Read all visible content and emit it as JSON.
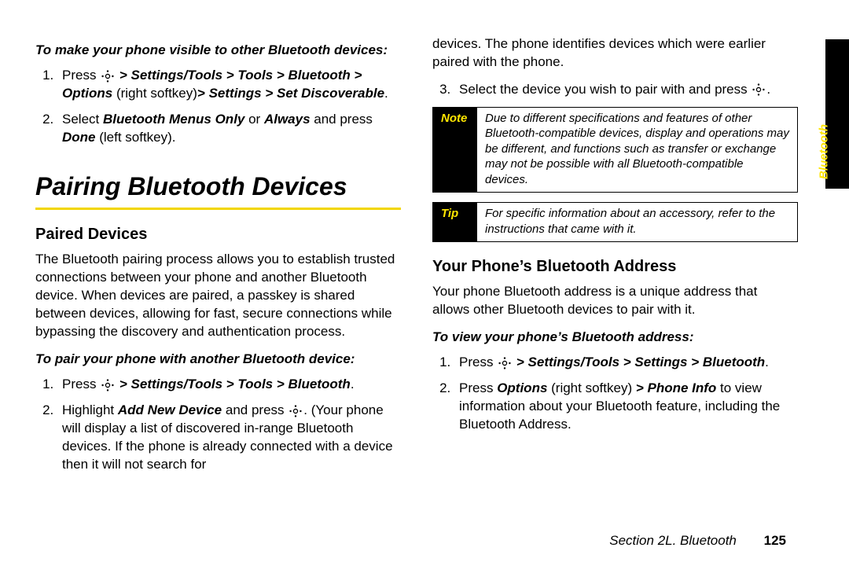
{
  "sideTab": "Bluetooth",
  "footer": {
    "section": "Section 2L. Bluetooth",
    "page": "125"
  },
  "left": {
    "lead1": "To make your phone visible to other Bluetooth devices:",
    "step1a": "Press ",
    "step1b": " > Settings/Tools > Tools > Bluetooth > Options",
    "step1c": " (right softkey)",
    "step1d": "> Settings > Set Discoverable",
    "step1e": ".",
    "step2a": " Select ",
    "step2b": "Bluetooth Menus Only",
    "step2c": " or ",
    "step2d": "Always",
    "step2e": " and press ",
    "step2f": "Done",
    "step2g": " (left softkey).",
    "heading": "Pairing Bluetooth Devices",
    "sub1": "Paired Devices",
    "para1": "The Bluetooth pairing process allows you to establish trusted connections between your phone and another Bluetooth device. When devices are paired, a passkey is shared between devices, allowing for fast, secure connections while bypassing the discovery and authentication process.",
    "lead2": "To pair your phone with another Bluetooth device:",
    "p2s1a": "Press ",
    "p2s1b": " > Settings/Tools > Tools > Bluetooth",
    "p2s1c": ".",
    "p2s2a": "Highlight ",
    "p2s2b": "Add New Device",
    "p2s2c": " and press ",
    "p2s2d": ". (Your phone will display a list of discovered in-range Bluetooth devices. If the phone is already connected with a device then it will not search for"
  },
  "right": {
    "cont": "devices. The phone identifies devices which were earlier paired with the phone.",
    "s3a": "Select the device you wish to pair with and press ",
    "s3b": ".",
    "noteLabel": "Note",
    "note": "Due to different specifications and features of other Bluetooth-compatible devices, display and operations may be different, and functions such as transfer or exchange may not be possible with all Bluetooth-compatible devices.",
    "tipLabel": "Tip",
    "tip": "For specific information about an accessory, refer to the instructions that came with it.",
    "sub2": "Your Phone’s Bluetooth Address",
    "para2": "Your phone Bluetooth address is a unique address that allows other Bluetooth devices to pair with it.",
    "lead3": "To view your phone’s Bluetooth address:",
    "v1a": "Press ",
    "v1b": " > Settings/Tools > Settings > Bluetooth",
    "v1c": ".",
    "v2a": "Press ",
    "v2b": "Options",
    "v2c": " (right softkey) ",
    "v2d": "> Phone Info",
    "v2e": " to view information about your Bluetooth feature, including the Bluetooth Address."
  }
}
